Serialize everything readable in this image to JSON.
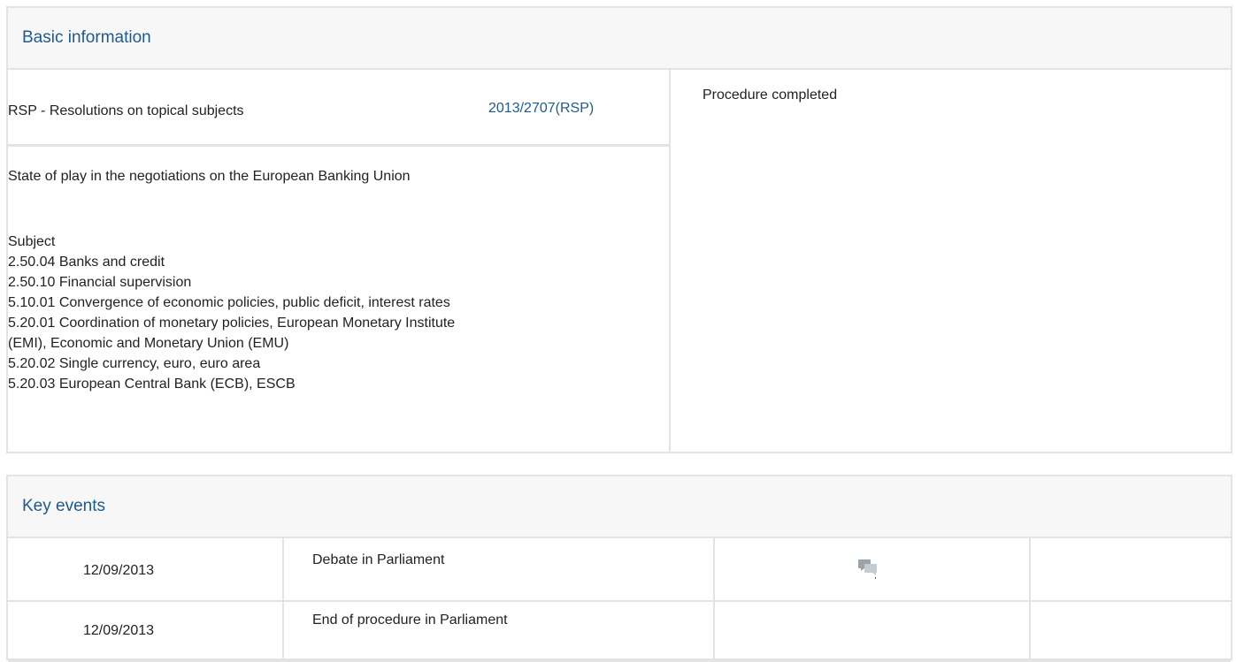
{
  "basic": {
    "header": "Basic information",
    "type": "RSP - Resolutions on topical subjects",
    "reference": "2013/2707(RSP)",
    "status": "Procedure completed",
    "title": "State of play in the negotiations on the European Banking Union",
    "subject_label": "Subject",
    "subjects": [
      "2.50.04 Banks and credit",
      "2.50.10 Financial supervision",
      "5.10.01 Convergence of economic policies, public deficit, interest rates",
      "5.20.01 Coordination of monetary policies, European Monetary Institute",
      "(EMI), Economic and Monetary Union (EMU)",
      "5.20.02 Single currency, euro, euro area",
      "5.20.03 European Central Bank (ECB), ESCB"
    ]
  },
  "events": {
    "header": "Key events",
    "rows": [
      {
        "date": "12/09/2013",
        "description": "Debate in Parliament",
        "icon": "debate-icon"
      },
      {
        "date": "12/09/2013",
        "description": "End of procedure in Parliament",
        "icon": ""
      }
    ]
  }
}
